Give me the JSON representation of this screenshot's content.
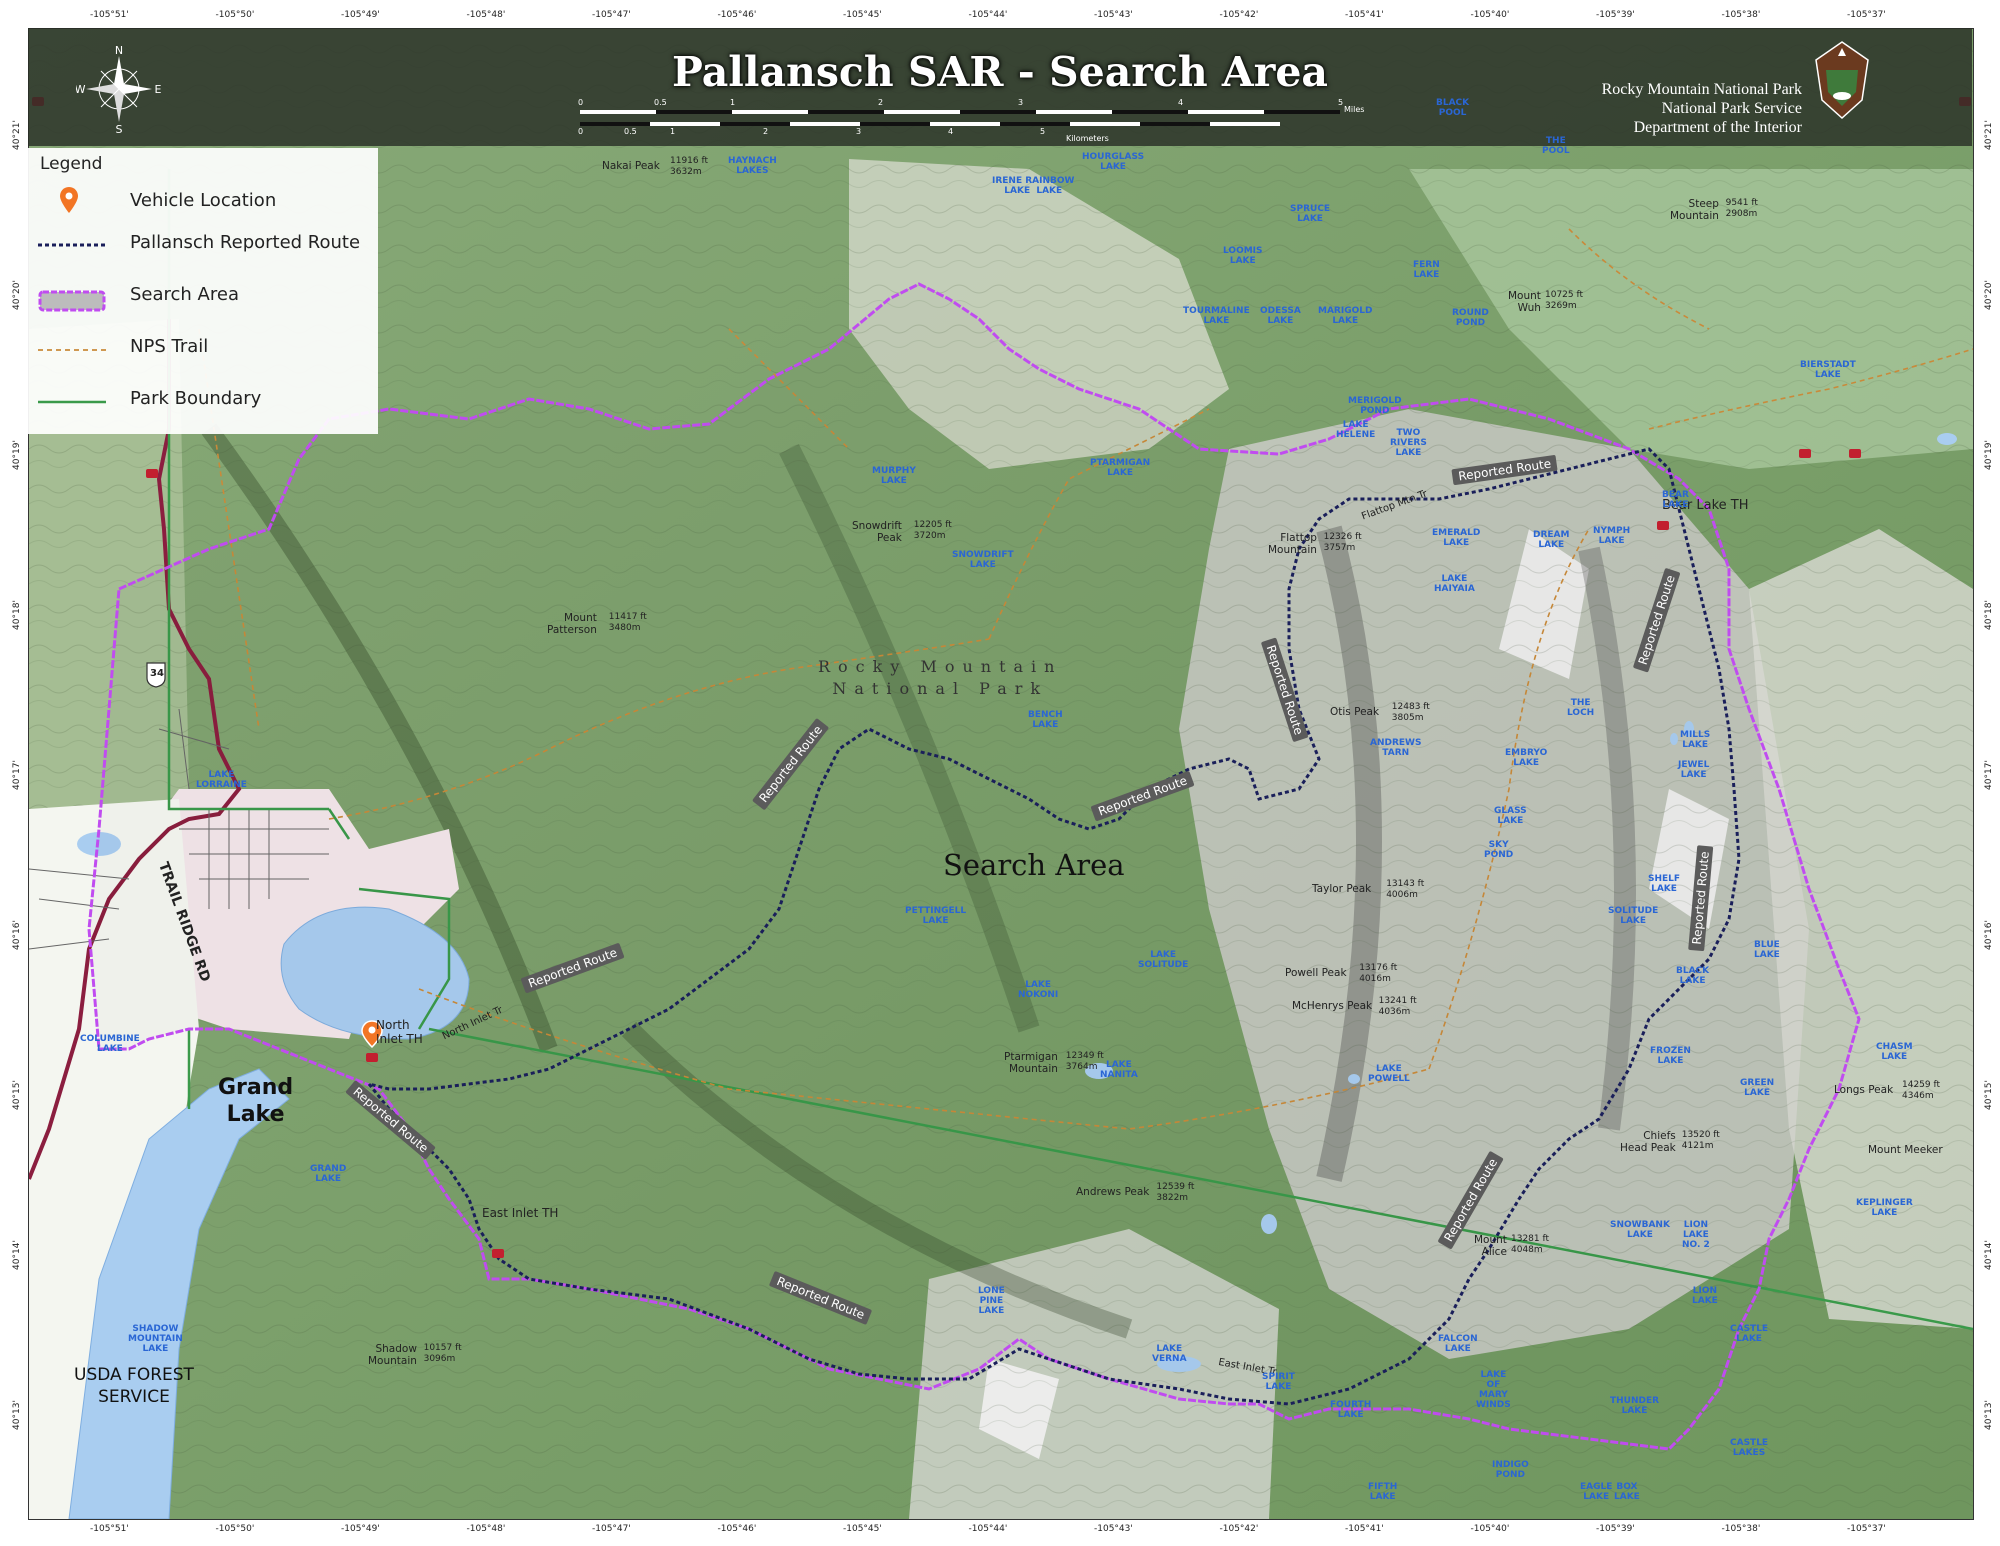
{
  "title": "Pallansch SAR - Search Area",
  "agency": [
    "Rocky Mountain National Park",
    "National Park Service",
    "Department of the Interior"
  ],
  "compass": {
    "n": "N",
    "s": "S",
    "e": "E",
    "w": "W"
  },
  "scale": {
    "miles_ticks": [
      "0",
      "0.5",
      "1",
      "2",
      "3",
      "4",
      "5"
    ],
    "miles_label": "Miles",
    "km_ticks": [
      "0",
      "0.5",
      "1",
      "2",
      "3",
      "4",
      "5"
    ],
    "km_label": "Kilometers"
  },
  "legend": {
    "title": "Legend",
    "items": [
      {
        "label": "Vehicle Location",
        "icon": "orange-pin-icon"
      },
      {
        "label": "Pallansch Reported Route",
        "icon": "navy-dotted-line"
      },
      {
        "label": "Search Area",
        "icon": "magenta-polygon"
      },
      {
        "label": "NPS Trail",
        "icon": "orange-dashed-line"
      },
      {
        "label": "Park Boundary",
        "icon": "green-line"
      }
    ]
  },
  "colors": {
    "terrain_green": "#7a9e6a",
    "alpine_grey": "#c9c9c5",
    "search_area": "#b23fd6",
    "route": "#1a1f5a",
    "water": "#a9cdf0",
    "trail": "#c98a3a",
    "park_boundary": "#3a9a4a",
    "road": "#8b1e3f",
    "town": "#f3e6ea"
  },
  "graticule": {
    "top": [
      "-105°51'",
      "-105°50'",
      "-105°49'",
      "-105°48'",
      "-105°47'",
      "-105°46'",
      "-105°45'",
      "-105°44'",
      "-105°43'",
      "-105°42'",
      "-105°41'",
      "-105°40'",
      "-105°39'",
      "-105°38'",
      "-105°37'"
    ],
    "left": [
      "40°21'",
      "40°20'",
      "40°19'",
      "40°18'",
      "40°17'",
      "40°16'",
      "40°15'",
      "40°14'",
      "40°13'"
    ]
  },
  "labels": {
    "search_area": "Search Area",
    "park": "Rocky Mountain\nNational Park",
    "town": "Grand\nLake",
    "forest": "USDA FOREST\nSERVICE",
    "trail_ridge": "TRAIL RIDGE RD",
    "north_inlet_th": "North\nInlet TH",
    "east_inlet_th": "East Inlet TH",
    "bear_lake_th": "Bear Lake TH",
    "north_inlet_tr": "North Inlet Tr",
    "east_inlet_tr": "East Inlet Tr",
    "flattop_mtn_tr": "Flattop Mtn Tr",
    "reported_route": "Reported Route",
    "us34": "34"
  },
  "peaks": [
    {
      "name": "Nakai Peak",
      "elev": "11916 ft\n3632m"
    },
    {
      "name": "Snowdrift\nPeak",
      "elev": "12205 ft\n3720m"
    },
    {
      "name": "Mount\nPatterson",
      "elev": "11417 ft\n3480m"
    },
    {
      "name": "Flattop\nMountain",
      "elev": "12326 ft\n3757m"
    },
    {
      "name": "Otis Peak",
      "elev": "12483 ft\n3805m"
    },
    {
      "name": "Taylor Peak",
      "elev": "13143 ft\n4006m"
    },
    {
      "name": "Powell Peak",
      "elev": "13176 ft\n4016m"
    },
    {
      "name": "McHenrys Peak",
      "elev": "13241 ft\n4036m"
    },
    {
      "name": "Ptarmigan\nMountain",
      "elev": "12349 ft\n3764m"
    },
    {
      "name": "Chiefs\nHead Peak",
      "elev": "13520 ft\n4121m"
    },
    {
      "name": "Andrews Peak",
      "elev": "12539 ft\n3822m"
    },
    {
      "name": "Mount\nAlice",
      "elev": "13281 ft\n4048m"
    },
    {
      "name": "Shadow\nMountain",
      "elev": "10157 ft\n3096m"
    },
    {
      "name": "Steep\nMountain",
      "elev": "9541 ft\n2908m"
    },
    {
      "name": "Mount\nWuh",
      "elev": "10725 ft\n3269m"
    },
    {
      "name": "Longs Peak",
      "elev": "14259 ft\n4346m"
    },
    {
      "name": "Mount Meeker",
      "elev": ""
    }
  ],
  "lakes": [
    "HAYNACH\nLAKES",
    "HOURGLASS\nLAKE",
    "IRENE RAINBOW\nLAKE  LAKE",
    "SPRUCE\nLAKE",
    "LOOMIS\nLAKE",
    "FERN\nLAKE",
    "TOURMALINE\nLAKE",
    "ODESSA\nLAKE",
    "MARIGOLD\nLAKE",
    "ROUND\nPOND",
    "BIERSTADT\nLAKE",
    "MURPHY\nLAKE",
    "PTARMIGAN\nLAKE",
    "SNOWDRIFT\nLAKE",
    "EMERALD\nLAKE",
    "DREAM\nLAKE",
    "NYMPH\nLAKE",
    "BEAR\nLAKE",
    "LAKE\nHAIYAIA",
    "BENCH\nLAKE",
    "ANDREWS\nTARN",
    "EMBRYO\nLAKE",
    "THE\nLOCH",
    "GLASS\nLAKE",
    "SKY\nPOND",
    "MILLS\nLAKE",
    "JEWEL\nLAKE",
    "SHELF\nLAKE",
    "SOLITUDE\nLAKE",
    "LAKE\nSOLITUDE",
    "PETTINGELL\nLAKE",
    "LAKE\nNOKONI",
    "LAKE\nNANITA",
    "BLACK\nLAKE",
    "BLUE\nLAKE",
    "FROZEN\nLAKE",
    "GREEN\nLAKE",
    "LAKE\nPOWELL",
    "CHASM\nLAKE",
    "KEPLINGER\nLAKE",
    "SNOWBANK\nLAKE",
    "LION\nLAKE\nNO. 2",
    "LION\nLAKE",
    "CASTLE\nLAKE",
    "FALCON\nLAKE",
    "LONE\nPINE\nLAKE",
    "LAKE\nVERNA",
    "SPIRIT\nLAKE",
    "FOURTH\nLAKE",
    "LAKE\nOF\nMARY\nWINDS",
    "THUNDER\nLAKE",
    "CASTLE\nLAKES",
    "INDIGO\nPOND",
    "EAGLE\nLAKE",
    "BOX\nLAKE",
    "FIFTH\nLAKE",
    "COLUMBINE\nLAKE",
    "GRAND\nLAKE",
    "SHADOW\nMOUNTAIN\nLAKE",
    "LAKE\nLORRAINE",
    "LAKE\nHELENE",
    "MERIGOLD\nPOND",
    "TWO\nRIVERS\nLAKE",
    "BLACK\nPOOL",
    "THE\nPOOL"
  ]
}
